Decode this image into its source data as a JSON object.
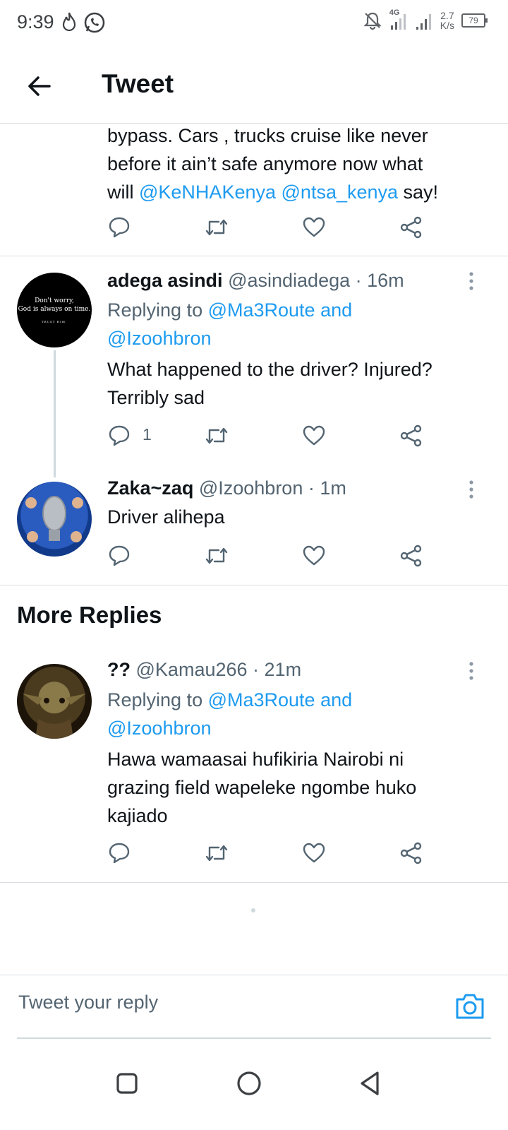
{
  "status_bar": {
    "time": "9:39",
    "network_type": "4G",
    "net_rate_value": "2.7",
    "net_rate_unit": "K/s",
    "battery": "79"
  },
  "header": {
    "title": "Tweet"
  },
  "tweet_continuation": {
    "line1": "bypass. Cars , trucks cruise like never",
    "line2": "before it ain’t safe anymore now what",
    "line3_prefix": "will ",
    "mention1": "@KeNHAKenya",
    "mention2": "@ntsa_kenya",
    "line3_suffix": " say!"
  },
  "replies": [
    {
      "name": "adega asindi",
      "handle": "@asindiadega",
      "time": "16m",
      "avatar_line1": "Don't worry,",
      "avatar_line2": "God is always on time.",
      "avatar_line3": "TRUST HIM.",
      "replying_prefix": "Replying to ",
      "replying_to1": "@Ma3Route and",
      "replying_to2": "@Izoohbron",
      "text_line1": "What happened to the driver? Injured?",
      "text_line2": "Terribly sad",
      "reply_count": "1"
    },
    {
      "name": "Zaka~zaq",
      "handle": "@Izoohbron",
      "time": "1m",
      "text_line1": "Driver alihepa"
    }
  ],
  "more_replies": {
    "title": "More Replies",
    "items": [
      {
        "name": "??",
        "handle": "@Kamau266",
        "time": "21m",
        "replying_prefix": "Replying to ",
        "replying_to1": "@Ma3Route and",
        "replying_to2": "@Izoohbron",
        "text_line1": "Hawa wamaasai hufikiria Nairobi ni",
        "text_line2": "grazing field wapeleke ngombe huko",
        "text_line3": "kajiado"
      }
    ]
  },
  "compose": {
    "placeholder": "Tweet your reply"
  },
  "separator": " · ",
  "colors": {
    "accent": "#1d9bf0",
    "text": "#0f1419",
    "muted": "#536471",
    "divider": "#d9dde1"
  },
  "icons": [
    "back-arrow-icon",
    "reply-icon",
    "retweet-icon",
    "like-icon",
    "share-icon",
    "more-icon",
    "camera-icon",
    "recent-apps-icon",
    "home-icon",
    "back-nav-icon"
  ]
}
